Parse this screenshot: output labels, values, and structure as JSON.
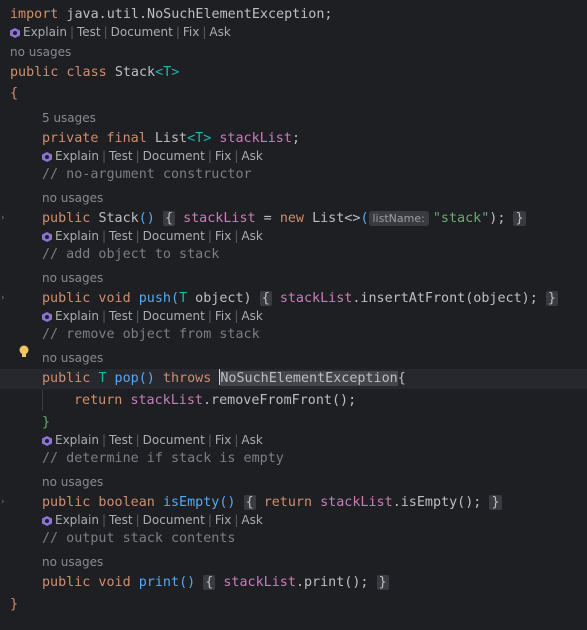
{
  "ai_hint": {
    "items": [
      "Explain",
      "Test",
      "Document",
      "Fix",
      "Ask"
    ]
  },
  "usages": {
    "no": "no usages",
    "five": "5 usages"
  },
  "code": {
    "l_import_kw": "import",
    "l_import_path": " java.util.NoSuchElementException;",
    "l_class_kw": "public class ",
    "l_class_name": "Stack",
    "l_class_gen": "<T>",
    "l_open": "{",
    "l_field_kw": "private final ",
    "l_field_type": "List",
    "l_field_gen": "<T>",
    "l_field_name": "stackList",
    "l_field_end": ";",
    "c_noarg": "// no-argument constructor",
    "l_ctor_kw": "public ",
    "l_ctor_name": "Stack",
    "l_ctor_paren": "()",
    "l_ctor_open": "{",
    "l_ctor_field": "stackList",
    "l_ctor_eq": " = ",
    "l_ctor_new": "new ",
    "l_ctor_type": "List<>",
    "l_ctor_lp": "(",
    "l_ctor_hint": "listName:",
    "l_ctor_str": "\"stack\"",
    "l_ctor_rp": ");",
    "l_ctor_close": "}",
    "c_push": "// add object to stack",
    "l_push_kw": "public void ",
    "l_push_name": "push",
    "l_push_lp": "(",
    "l_push_type": "T",
    "l_push_arg": " object)",
    "l_push_open": "{",
    "l_push_field": "stackList",
    "l_push_call": ".insertAtFront(object);",
    "l_push_close": "}",
    "c_pop": "// remove object from stack",
    "l_pop_kw": "public ",
    "l_pop_type": "T",
    "l_pop_name": " pop",
    "l_pop_paren": "()",
    "l_pop_throws": " throws ",
    "l_pop_exc": "NoSuchElementException",
    "l_pop_open": "{",
    "l_ret_kw": "return ",
    "l_ret_field": "stackList",
    "l_ret_call": ".removeFromFront();",
    "l_pop_close": "}",
    "c_empty": "// determine if stack is empty",
    "l_empty_kw": "public boolean ",
    "l_empty_name": "isEmpty",
    "l_empty_paren": "()",
    "l_empty_open": "{",
    "l_empty_ret": "return ",
    "l_empty_field": "stackList",
    "l_empty_call": ".isEmpty();",
    "l_empty_close": "}",
    "c_print": "// output stack contents",
    "l_print_kw": "public void ",
    "l_print_name": "print",
    "l_print_paren": "()",
    "l_print_open": "{",
    "l_print_field": "stackList",
    "l_print_call": ".print();",
    "l_print_close": "}",
    "l_close": "}"
  },
  "colors": {
    "background": "#1e1f22",
    "keyword": "#cf8e6d",
    "field": "#c77dbb",
    "function": "#56a8f5",
    "string": "#6aab73",
    "comment": "#7a7e85",
    "type_param": "#16baac"
  },
  "icons": [
    "ai-assistant-icon",
    "lightbulb-icon",
    "fold-marker-icon"
  ]
}
